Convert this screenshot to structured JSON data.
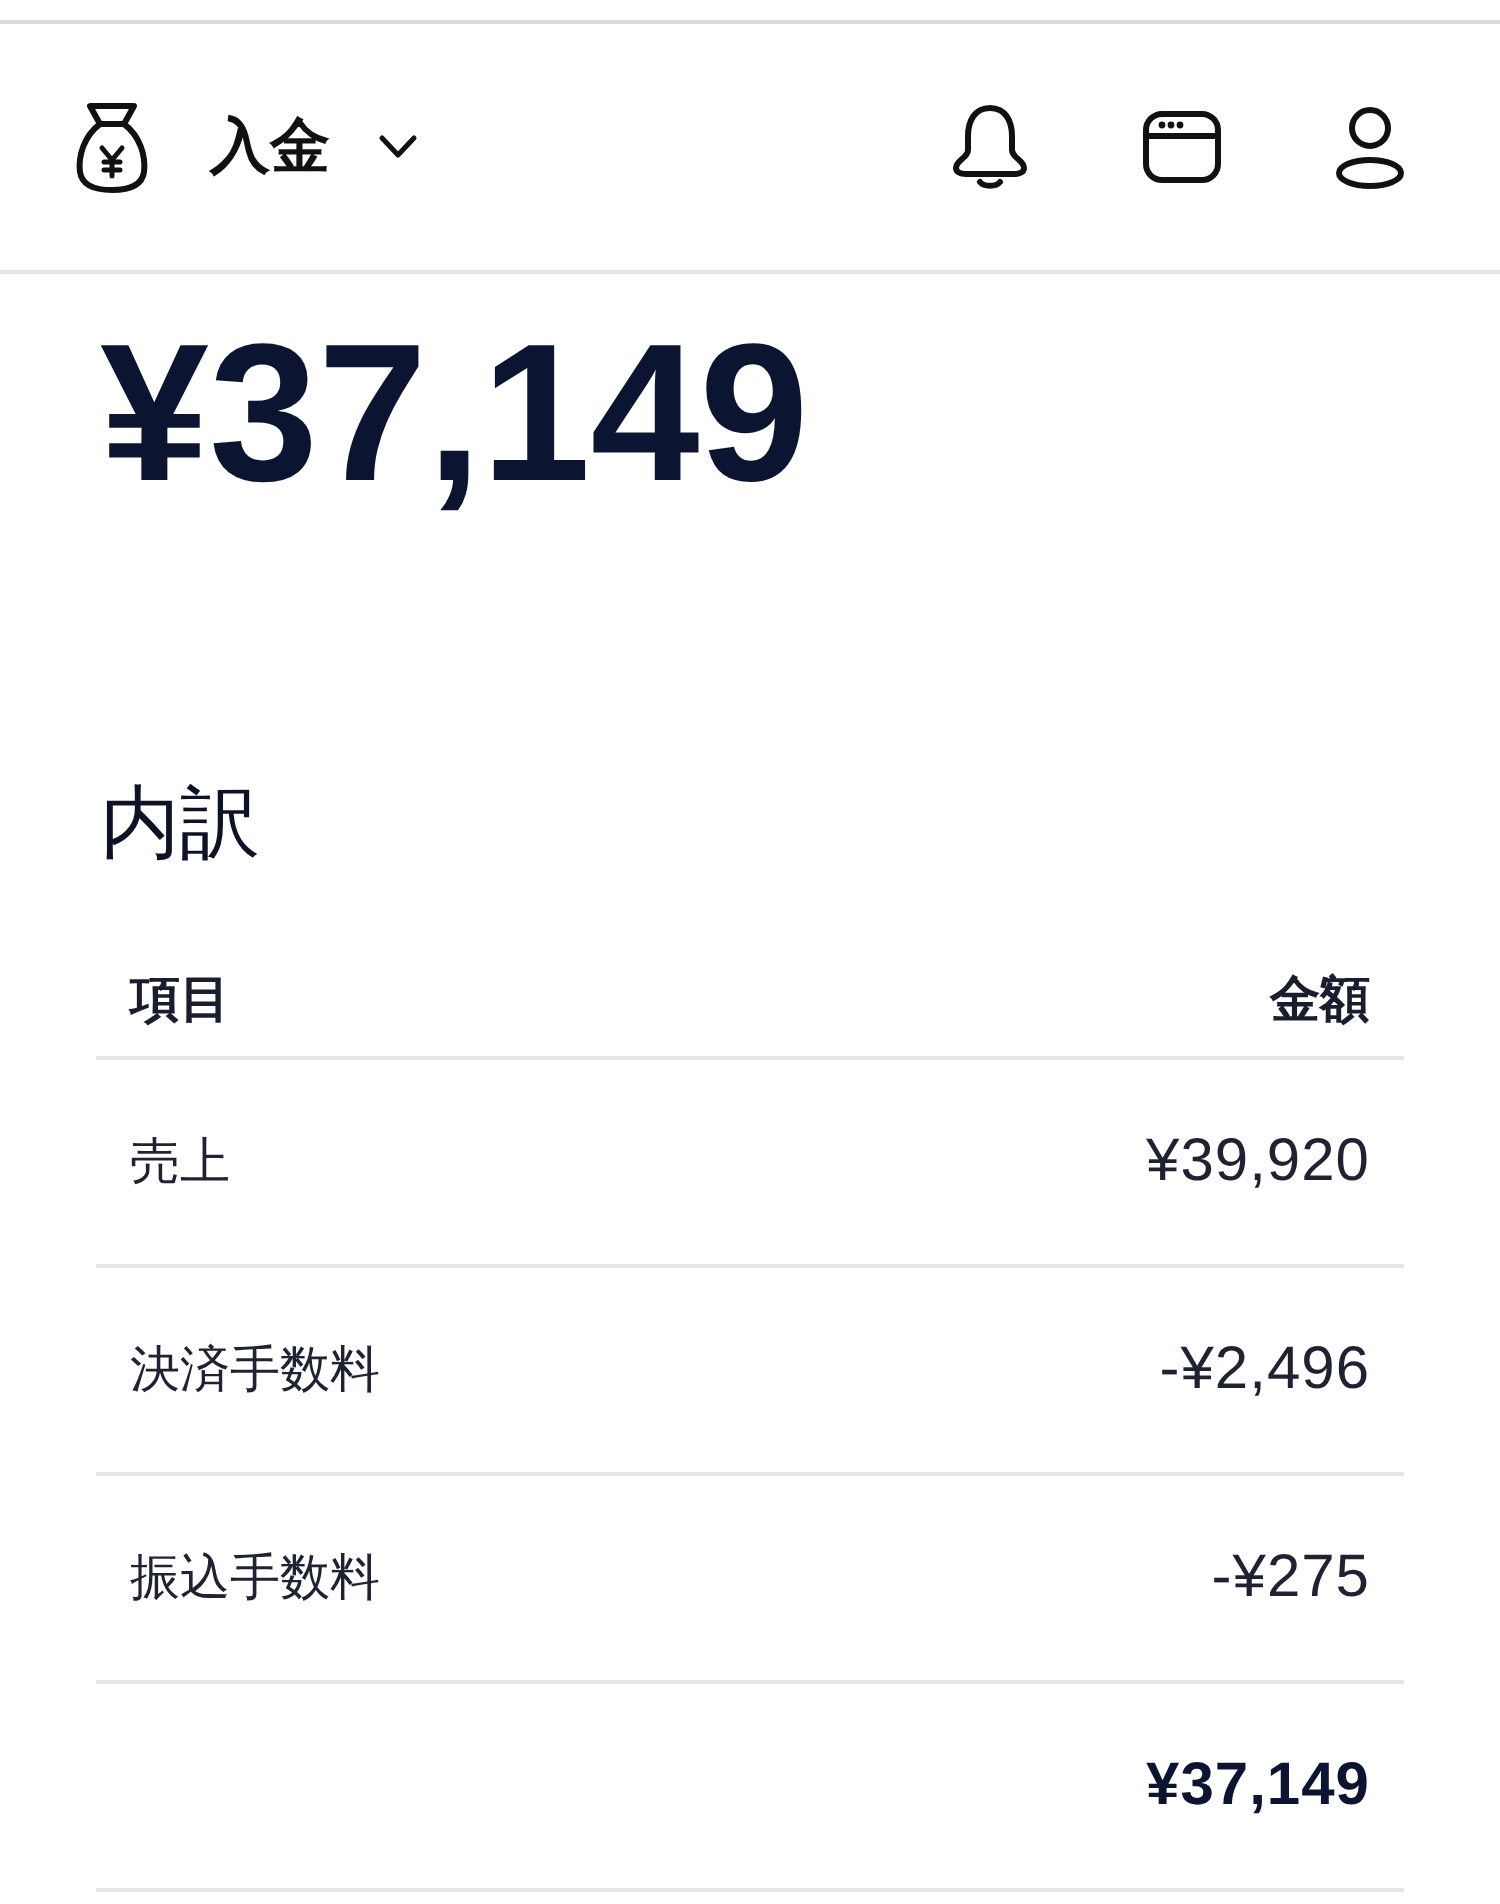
{
  "header": {
    "title": "入金"
  },
  "balance": {
    "amount": "¥37,149"
  },
  "breakdown": {
    "title": "内訳",
    "columns": [
      "項目",
      "金額"
    ],
    "rows": [
      {
        "kind": "line",
        "item": "売上",
        "amount": "¥39,920"
      },
      {
        "kind": "line",
        "item": "決済手数料",
        "amount": "-¥2,496"
      },
      {
        "kind": "line",
        "item": "振込手数料",
        "amount": "-¥275"
      },
      {
        "kind": "total",
        "amount": "¥37,149"
      }
    ]
  }
}
